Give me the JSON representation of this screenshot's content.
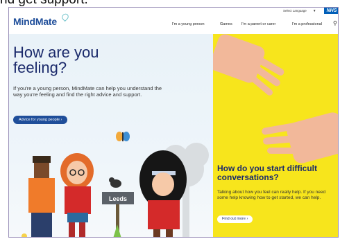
{
  "page_caption": "nd get support.",
  "header": {
    "logo": "MindMate",
    "language_select": "Select Language",
    "language_caret": "▼",
    "nhs_badge": "NHS",
    "nav": [
      "I'm a young person",
      "Games",
      "I'm a parent or carer",
      "I'm a professional"
    ]
  },
  "hero": {
    "title": "How are you feeling?",
    "text": "If you're a young person, MindMate can help you understand the way you're feeling and find the right advice and support.",
    "button": "Advice for young people  ›",
    "sign_text": "Leeds"
  },
  "promo": {
    "title": "How do you start difficult conversations?",
    "text": "Talking about how you feel can really help. If you need some help knowing how to get started, we can help.",
    "button": "Find out more  ›"
  },
  "colors": {
    "brand_blue": "#1f4e9a",
    "promo_yellow": "#f7e51c",
    "nhs_blue": "#005eb8"
  }
}
